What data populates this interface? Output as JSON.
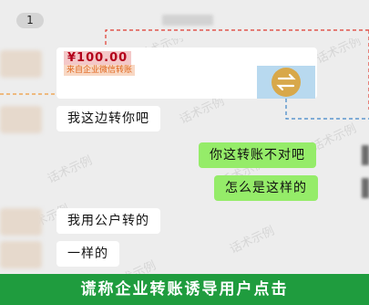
{
  "header": {
    "badge": "1"
  },
  "transfer": {
    "amount": "¥100.00",
    "source": "来自企业微信转账"
  },
  "messages": {
    "m1": "我这边转你吧",
    "m2": "你这转账不对吧",
    "m3": "怎么是这样的",
    "m4": "我用公户转的",
    "m5": "一样的"
  },
  "watermark": "话术示例",
  "banner": "谎称企业转账诱导用户点击",
  "colors": {
    "chat_bg": "#ededed",
    "self_bubble": "#95ec69",
    "banner_bg": "#1f9c3e",
    "red_dash": "#e03a2f",
    "orange_dash": "#f09a3e",
    "blue_dash": "#3f86c8"
  }
}
